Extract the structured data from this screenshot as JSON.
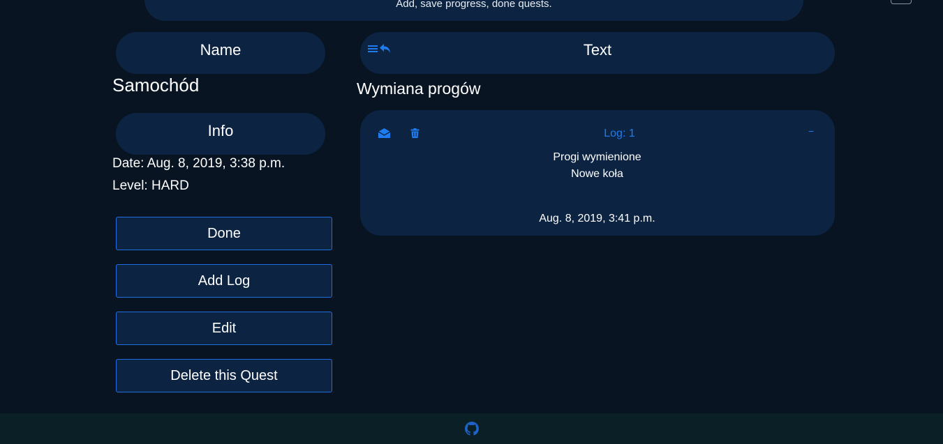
{
  "banner": {
    "subtitle": "Add, save progress, done quests."
  },
  "headers": {
    "name": "Name",
    "info": "Info",
    "text": "Text"
  },
  "quest": {
    "name": "Samochód",
    "title": "Wymiana progów",
    "date": "Date: Aug. 8, 2019, 3:38 p.m.",
    "level": "Level: HARD"
  },
  "actions": {
    "done": "Done",
    "add_log": "Add Log",
    "edit": "Edit",
    "delete": "Delete this Quest"
  },
  "log": {
    "number": "Log: 1",
    "minimize": "−",
    "lines": [
      "Progi wymienione",
      "Nowe koła"
    ],
    "date": "Aug. 8, 2019, 3:41 p.m."
  },
  "icons": {
    "list": "list-icon",
    "back": "reply-arrow-icon",
    "read": "open-envelope-icon",
    "delete": "trash-icon",
    "footer": "github-icon"
  },
  "colors": {
    "background": "#081422",
    "panel": "#0c2442",
    "accent": "#1f7cf0",
    "footer": "#0b1f26"
  }
}
